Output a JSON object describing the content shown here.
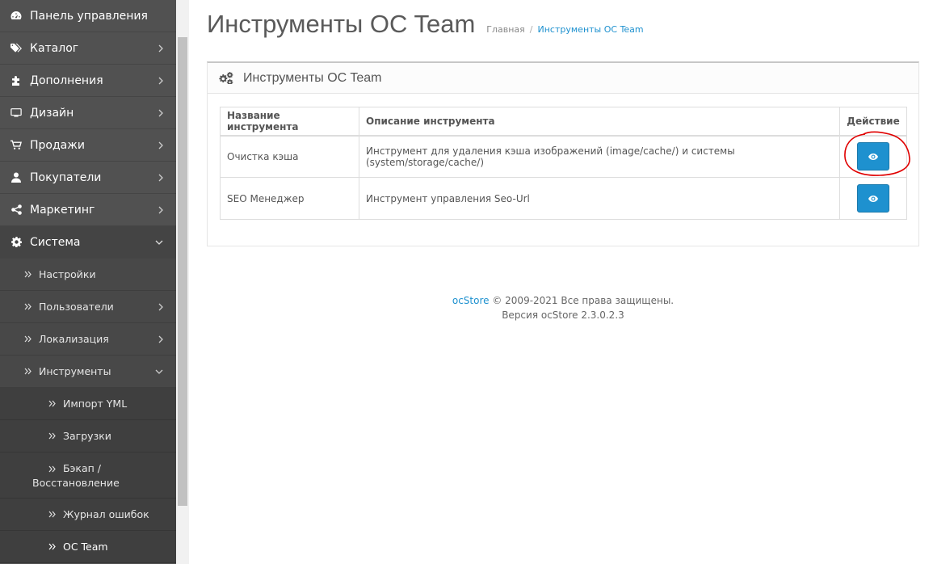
{
  "sidebar": {
    "items": [
      {
        "label": "Панель управления",
        "icon": "dashboard-icon",
        "has_children": false
      },
      {
        "label": "Каталог",
        "icon": "tags-icon",
        "has_children": true
      },
      {
        "label": "Дополнения",
        "icon": "puzzle-icon",
        "has_children": true
      },
      {
        "label": "Дизайн",
        "icon": "monitor-icon",
        "has_children": true
      },
      {
        "label": "Продажи",
        "icon": "cart-icon",
        "has_children": true
      },
      {
        "label": "Покупатели",
        "icon": "user-icon",
        "has_children": true
      },
      {
        "label": "Маркетинг",
        "icon": "share-icon",
        "has_children": true
      },
      {
        "label": "Система",
        "icon": "gear-icon",
        "has_children": true,
        "expanded": true
      }
    ],
    "system_children": [
      {
        "label": "Настройки"
      },
      {
        "label": "Пользователи"
      },
      {
        "label": "Локализация"
      },
      {
        "label": "Инструменты"
      }
    ],
    "tools_children": [
      {
        "label": "Импорт YML"
      },
      {
        "label": "Загрузки"
      },
      {
        "label": "Бэкап / Восстановление",
        "line1": "Бэкап /",
        "line2": "Восстановление"
      },
      {
        "label": "Журнал ошибок"
      },
      {
        "label": "OC Team"
      }
    ]
  },
  "header": {
    "title": "Инструменты OC Team",
    "breadcrumb": {
      "home": "Главная",
      "separator": "/",
      "current": "Инструменты OC Team"
    }
  },
  "panel": {
    "title": "Инструменты OC Team",
    "icon": "cogs-icon",
    "table": {
      "columns": [
        "Название инструмента",
        "Описание инструмента",
        "Действие"
      ],
      "rows": [
        {
          "name": "Очистка кэша",
          "description": "Инструмент для удаления кэша изображений (image/cache/) и системы (system/storage/cache/)",
          "action_icon": "eye-icon"
        },
        {
          "name": "SEO Менеджер",
          "description": "Инструмент управления Seo-Url",
          "action_icon": "eye-icon"
        }
      ]
    }
  },
  "footer": {
    "brand": "ocStore",
    "rights": "© 2009-2021 Все права защищены.",
    "version": "Версия ocStore 2.3.0.2.3"
  },
  "colors": {
    "sidebar_bg": "#515151",
    "accent": "#1e91cf",
    "annotation": "#e00000"
  }
}
